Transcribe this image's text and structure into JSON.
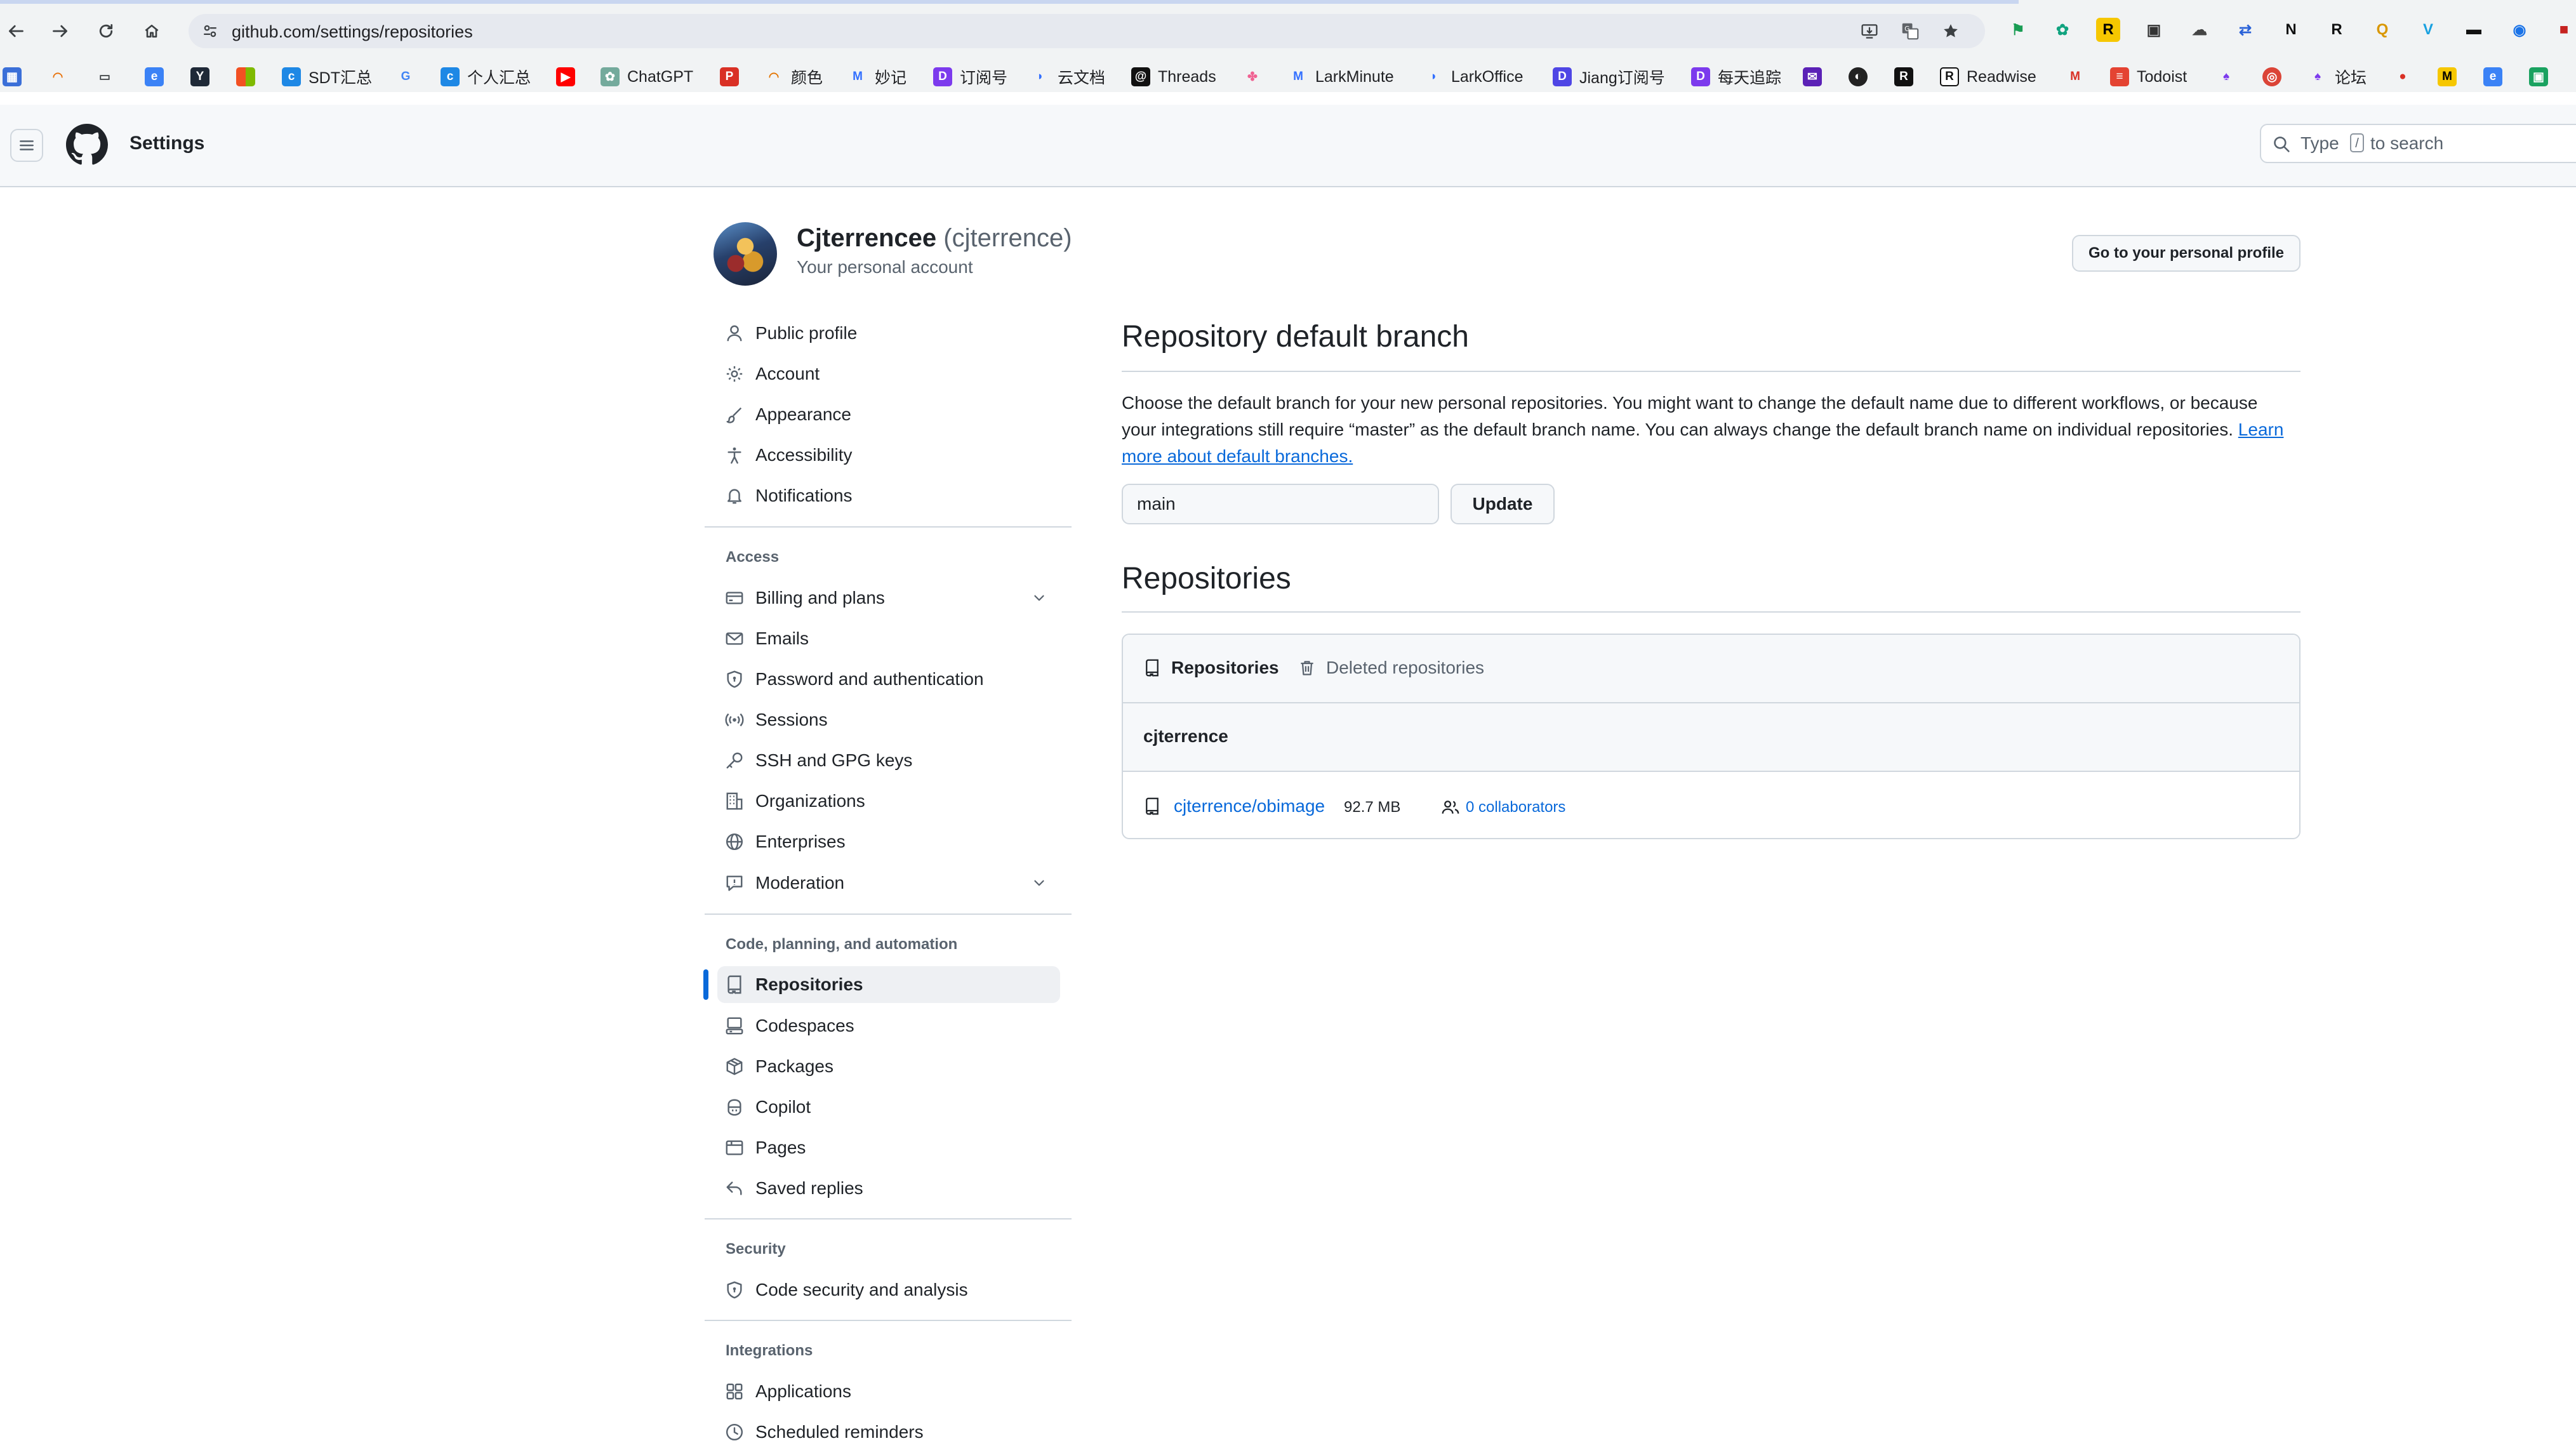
{
  "browser": {
    "url": "github.com/settings/repositories",
    "bookmarks": [
      {
        "label": "SDT汇总"
      },
      {
        "label": "个人汇总"
      },
      {
        "label": "ChatGPT"
      },
      {
        "label": "颜色"
      },
      {
        "label": "妙记"
      },
      {
        "label": "订阅号"
      },
      {
        "label": "云文档"
      },
      {
        "label": "Threads"
      },
      {
        "label": "LarkMinute"
      },
      {
        "label": "LarkOffice"
      },
      {
        "label": "Jiang订阅号"
      },
      {
        "label": "每天追踪"
      },
      {
        "label": "Readwise"
      },
      {
        "label": "Todoist"
      },
      {
        "label": "论坛"
      }
    ]
  },
  "header": {
    "title": "Settings",
    "search_prefix": "Type",
    "search_key": "/",
    "search_suffix": "to search"
  },
  "account": {
    "display_name": "Cjterrencee",
    "login": "(cjterrence)",
    "subtitle": "Your personal account",
    "profile_button": "Go to your personal profile"
  },
  "sidebar": {
    "items": [
      {
        "label": "Public profile"
      },
      {
        "label": "Account"
      },
      {
        "label": "Appearance"
      },
      {
        "label": "Accessibility"
      },
      {
        "label": "Notifications"
      }
    ],
    "access_heading": "Access",
    "access_items": [
      {
        "label": "Billing and plans"
      },
      {
        "label": "Emails"
      },
      {
        "label": "Password and authentication"
      },
      {
        "label": "Sessions"
      },
      {
        "label": "SSH and GPG keys"
      },
      {
        "label": "Organizations"
      },
      {
        "label": "Enterprises"
      },
      {
        "label": "Moderation"
      }
    ],
    "code_heading": "Code, planning, and automation",
    "code_items": [
      {
        "label": "Repositories"
      },
      {
        "label": "Codespaces"
      },
      {
        "label": "Packages"
      },
      {
        "label": "Copilot"
      },
      {
        "label": "Pages"
      },
      {
        "label": "Saved replies"
      }
    ],
    "security_heading": "Security",
    "security_items": [
      {
        "label": "Code security and analysis"
      }
    ],
    "integrations_heading": "Integrations",
    "integrations_items": [
      {
        "label": "Applications"
      },
      {
        "label": "Scheduled reminders"
      }
    ]
  },
  "main": {
    "branch_title": "Repository default branch",
    "branch_desc": "Choose the default branch for your new personal repositories. You might want to change the default name due to different workflows, or because your integrations still require “master” as the default branch name. You can always change the default branch name on individual repositories.",
    "branch_link": "Learn more about default branches.",
    "branch_value": "main",
    "update_button": "Update",
    "repos_title": "Repositories",
    "tab_repositories": "Repositories",
    "tab_deleted": "Deleted repositories",
    "owner": "cjterrence",
    "repo_name": "cjterrence/obimage",
    "repo_size": "92.7 MB",
    "collaborators": "0 collaborators"
  },
  "colors": {
    "accent": "#0969da",
    "border": "#d0d7de",
    "muted_text": "#59636e",
    "header_bg": "#f6f8fa"
  }
}
